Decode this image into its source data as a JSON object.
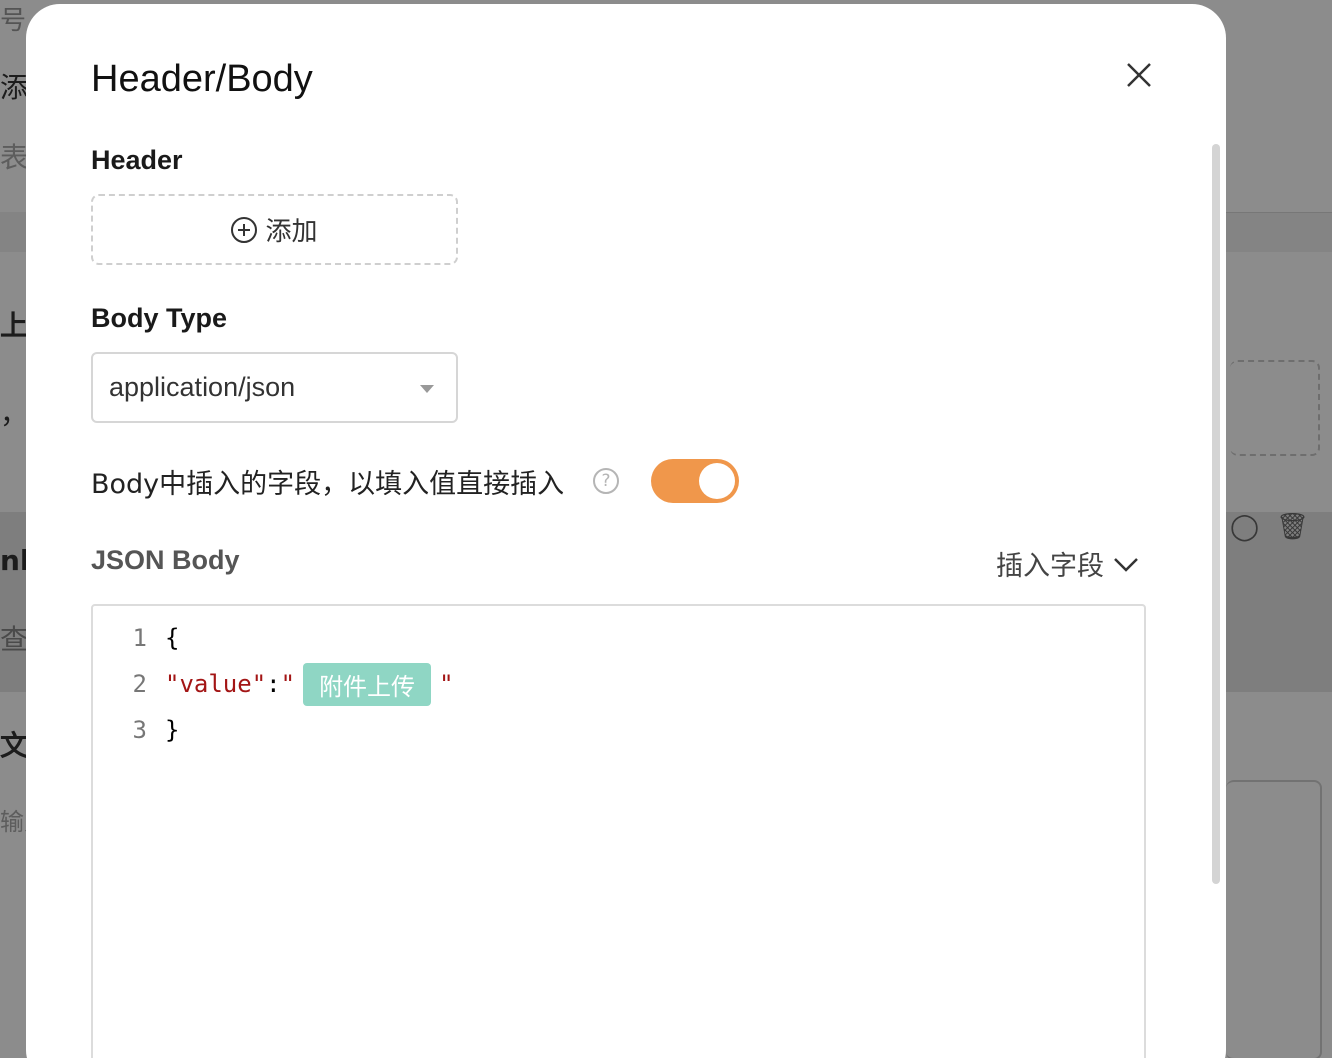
{
  "background": {
    "fragments": [
      "号",
      "添加",
      "表单",
      "上",
      "，拍",
      "nk",
      "查询",
      "文",
      "输入"
    ]
  },
  "modal": {
    "title": "Header/Body",
    "close_icon": "close-icon",
    "header_section": {
      "label": "Header",
      "add_label": "添加",
      "add_icon": "plus-circle-icon"
    },
    "body_type": {
      "label": "Body Type",
      "selected": "application/json"
    },
    "insert_toggle": {
      "label": "Body中插入的字段，以填入值直接插入",
      "help_icon": "question-circle-icon",
      "help_glyph": "?",
      "on": true,
      "color": "#f0974b"
    },
    "json_body": {
      "label": "JSON Body",
      "insert_field_label": "插入字段",
      "lines": [
        {
          "no": "1",
          "text": "{"
        },
        {
          "no": "2",
          "key": "\"value\"",
          "colon": ":",
          "quote_open": "\"",
          "chip": "附件上传",
          "quote_close": "\""
        },
        {
          "no": "3",
          "text": "}"
        }
      ],
      "chip_color": "#8fd6c4"
    }
  }
}
